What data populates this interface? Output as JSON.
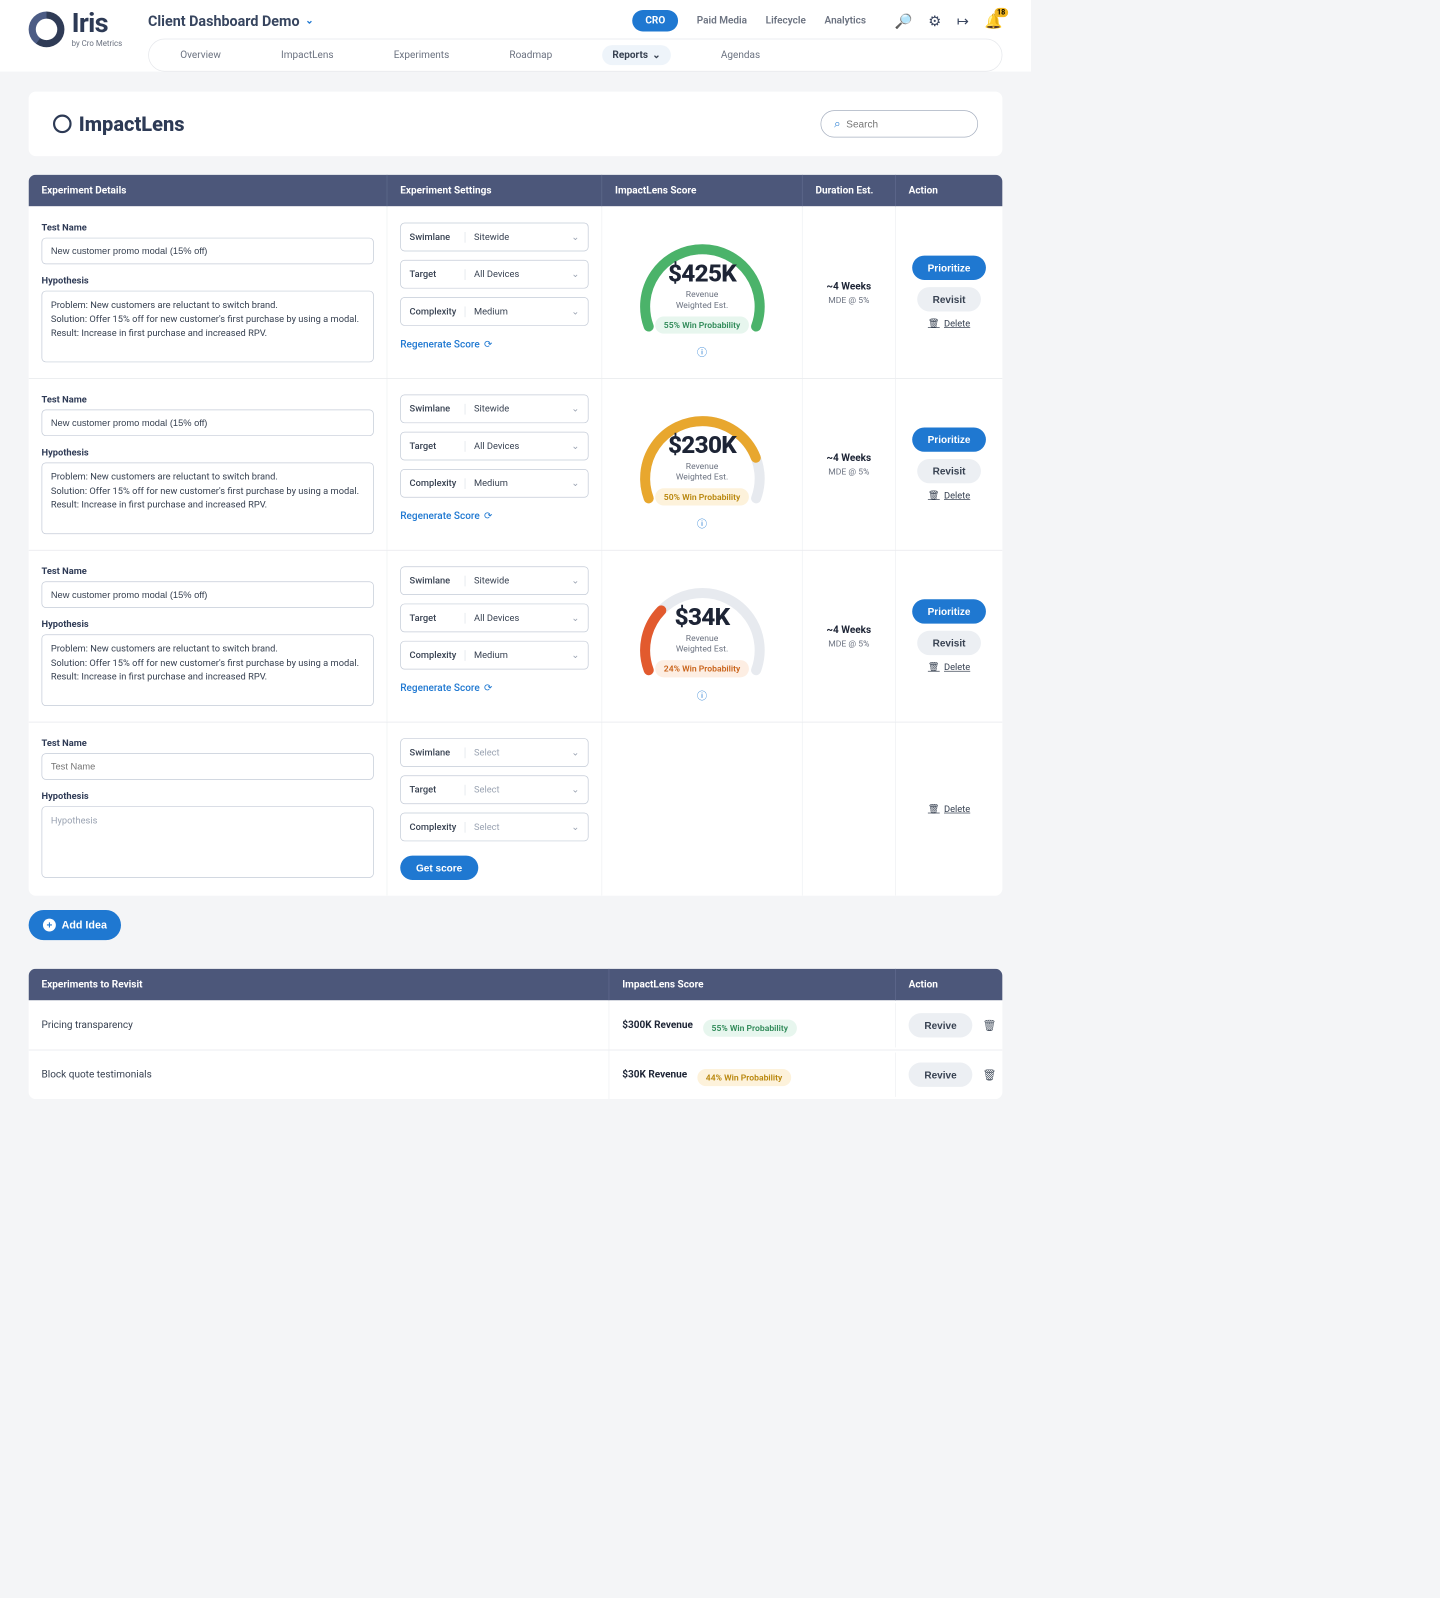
{
  "header": {
    "logo_text": "Iris",
    "logo_sub": "by Cro Metrics",
    "client_title": "Client Dashboard Demo",
    "main_nav": [
      "CRO",
      "Paid Media",
      "Lifecycle",
      "Analytics"
    ],
    "notif_count": "18",
    "sub_nav": [
      "Overview",
      "ImpactLens",
      "Experiments",
      "Roadmap",
      "Reports",
      "Agendas"
    ],
    "sub_nav_active": "Reports"
  },
  "page": {
    "title": "ImpactLens",
    "search_placeholder": "Search"
  },
  "columns": {
    "a": "Experiment Details",
    "b": "Experiment Settings",
    "c": "ImpactLens Score",
    "d": "Duration Est.",
    "e": "Action"
  },
  "labels": {
    "test_name": "Test Name",
    "hypothesis": "Hypothesis",
    "test_name_ph": "Test Name",
    "hypothesis_ph": "Hypothesis",
    "swimlane": "Swimlane",
    "target": "Target",
    "complexity": "Complexity",
    "select_ph": "Select",
    "regen": "Regenerate Score",
    "get_score": "Get score",
    "prioritize": "Prioritize",
    "revisit": "Revisit",
    "delete": "Delete",
    "revive": "Revive",
    "add_idea": "Add Idea",
    "rev_sub": "Revenue\nWeighted Est."
  },
  "test_value": "New customer promo modal (15% off)",
  "hyp_value": "Problem: New customers are reluctant to switch brand.\nSolution: Offer 15% off for new customer's first purchase by using a modal.\nResult: Increase in first purchase and increased RPV.",
  "settings": {
    "swimlane": "Sitewide",
    "target": "All Devices",
    "complexity": "Medium"
  },
  "rows": [
    {
      "value": "$425K",
      "prob_text": "55% Win Probability",
      "prob_class": "chip-green",
      "arc_color": "#4bb36a",
      "arc_dash": "330 500",
      "duration": "~4 Weeks",
      "mde": "MDE @ 5%"
    },
    {
      "value": "$230K",
      "prob_text": "50% Win Probability",
      "prob_class": "chip-yellow",
      "arc_color": "#e8a72e",
      "arc_dash": "250 500",
      "duration": "~4 Weeks",
      "mde": "MDE @ 5%"
    },
    {
      "value": "$34K",
      "prob_text": "24% Win Probability",
      "prob_class": "chip-orange",
      "arc_color": "#e25a2e",
      "arc_dash": "90 500",
      "duration": "~4 Weeks",
      "mde": "MDE @ 5%"
    }
  ],
  "revisit_cols": {
    "a": "Experiments to Revisit",
    "b": "ImpactLens Score",
    "c": "Action"
  },
  "revisit": [
    {
      "name": "Pricing transparency",
      "rev": "$300K Revenue",
      "prob": "55% Win Probability",
      "pclass": "chip-green"
    },
    {
      "name": "Block quote testimonials",
      "rev": "$30K Revenue",
      "prob": "44% Win Probability",
      "pclass": "chip-yellow"
    }
  ]
}
